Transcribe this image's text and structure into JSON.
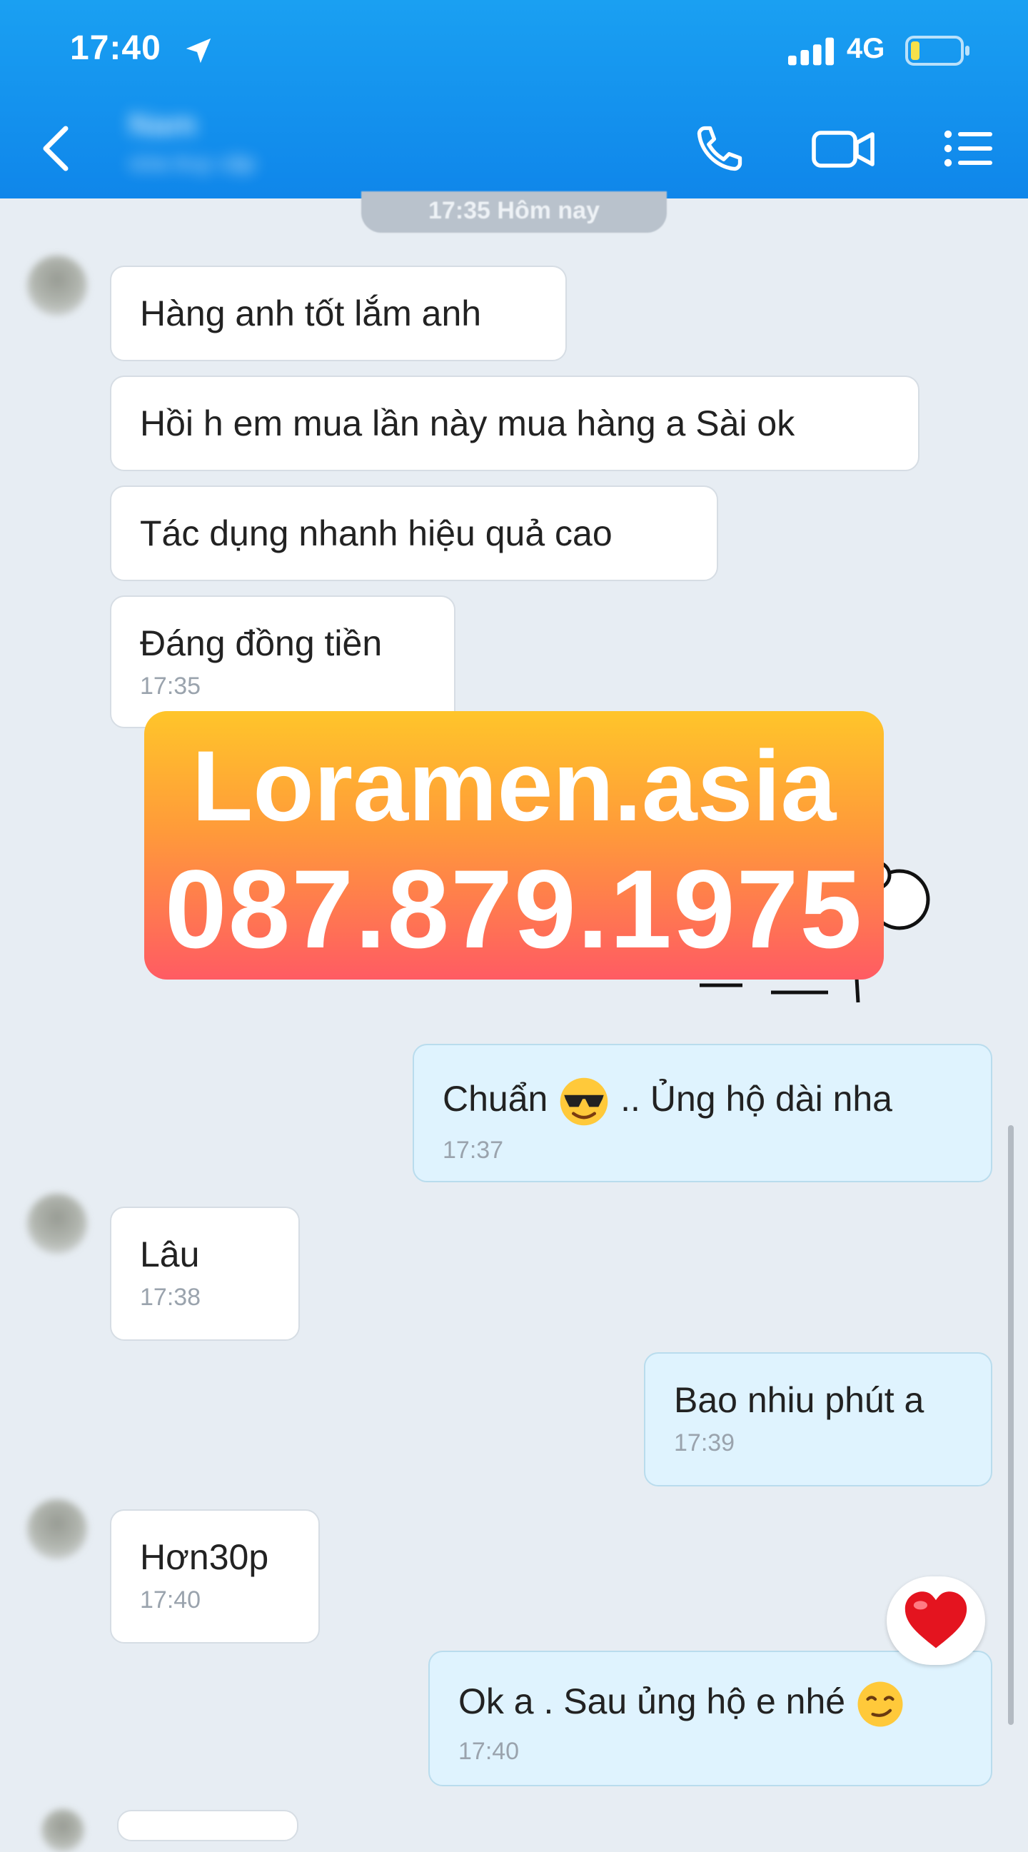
{
  "status_bar": {
    "time": "17:40",
    "network": "4G",
    "icons": [
      "location-arrow-icon",
      "signal-bars-icon",
      "battery-icon"
    ]
  },
  "header": {
    "contact_name": "Nam",
    "contact_status": "vừa truy cập",
    "icons": [
      "back-arrow-icon",
      "phone-icon",
      "video-camera-icon",
      "menu-list-icon"
    ],
    "color": "#1a9cf0"
  },
  "chat": {
    "date_divider": "17:35 Hôm nay",
    "messages": [
      {
        "direction": "in",
        "text": "Hàng anh tốt lắm anh"
      },
      {
        "direction": "in",
        "text": "Hồi h em mua lần này mua hàng a Sài ok"
      },
      {
        "direction": "in",
        "text": "Tác dụng nhanh hiệu quả cao"
      },
      {
        "direction": "in",
        "text": "Đáng đồng tiền",
        "time": "17:35"
      },
      {
        "direction": "out",
        "text_before": "Chuẩn",
        "emoji": "sunglasses-face-emoji",
        "text_after": ".. Ủng hộ dài nha",
        "time": "17:37"
      },
      {
        "direction": "in",
        "text": "Lâu",
        "time": "17:38"
      },
      {
        "direction": "out",
        "text": "Bao nhiu phút a",
        "time": "17:39"
      },
      {
        "direction": "in",
        "text": "Hơn30p",
        "time": "17:40"
      },
      {
        "direction": "out",
        "text": "Ok a . Sau ủng hộ e nhé",
        "emoji": "smirk-face-emoji",
        "time": "17:40",
        "reaction": "heart-emoji"
      }
    ]
  },
  "overlay": {
    "domain": "Loramen.asia",
    "phone": "087.879.1975",
    "colors": [
      "#ffc52a",
      "#ff9a3a",
      "#ff5b63"
    ]
  }
}
